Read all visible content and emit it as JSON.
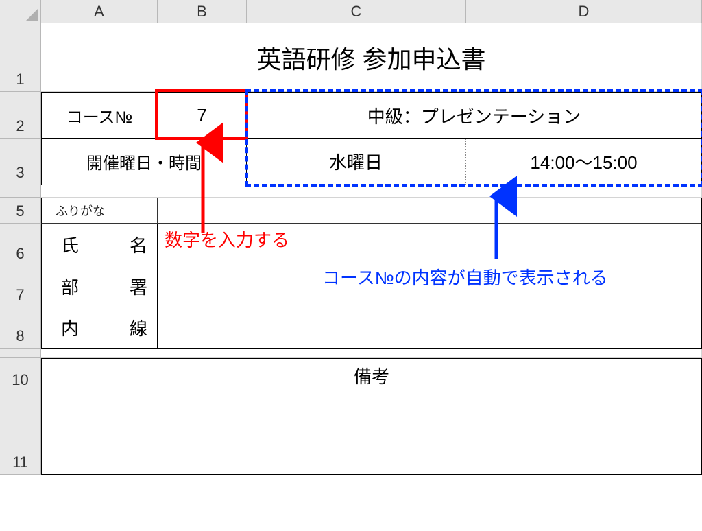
{
  "columns": [
    "A",
    "B",
    "C",
    "D"
  ],
  "rows": [
    "1",
    "2",
    "3",
    "5",
    "6",
    "7",
    "8",
    "10",
    "11"
  ],
  "title": "英語研修 参加申込書",
  "table": {
    "courseNoLabel": "コース№",
    "courseNoValue": "7",
    "courseName": "中級：プレゼンテーション",
    "scheduleLabel": "開催曜日・時間",
    "day": "水曜日",
    "time": "14:00～15:00",
    "furigana": "ふりがな",
    "nameLabel": "氏　名",
    "deptLabel": "部　署",
    "extLabel": "内　線",
    "remarksLabel": "備考"
  },
  "annotations": {
    "red": "数字を入力する",
    "blue": "コース№の内容が自動で表示される"
  }
}
